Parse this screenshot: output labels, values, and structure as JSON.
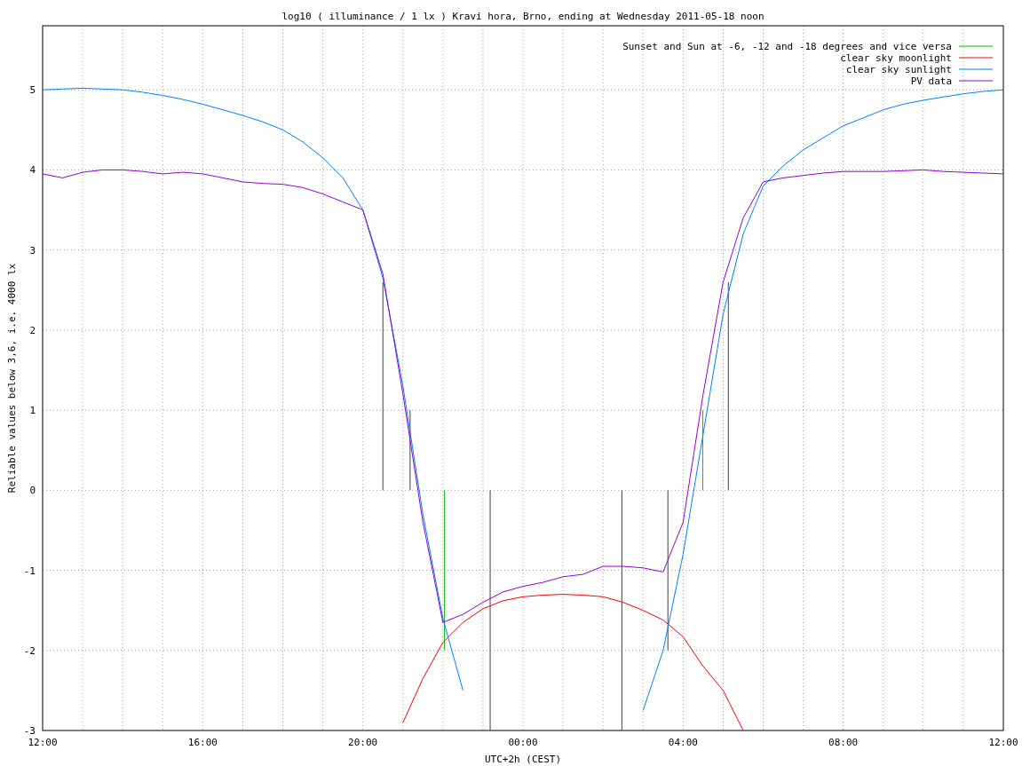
{
  "chart_data": {
    "type": "line",
    "title": "log10 ( illuminance / 1 lx ) Kravi hora, Brno, ending at Wednesday 2011-05-18 noon",
    "xlabel": "UTC+2h (CEST)",
    "ylabel": "Reliable values below 3,6, i.e. 4000 lx",
    "categories": [
      "12:00",
      null,
      null,
      null,
      null,
      null,
      null,
      null,
      "16:00",
      null,
      null,
      null,
      null,
      null,
      null,
      null,
      "20:00",
      null,
      null,
      null,
      null,
      null,
      null,
      null,
      "00:00",
      null,
      null,
      null,
      null,
      null,
      null,
      null,
      "04:00",
      null,
      null,
      null,
      null,
      null,
      null,
      null,
      "08:00",
      null,
      null,
      null,
      null,
      null,
      null,
      null,
      "12:00"
    ],
    "series": [
      {
        "name": "Sunset and Sun at -6, -12 and -18 degrees and vice versa",
        "color": "#00c000",
        "values": [
          null,
          null,
          null,
          null,
          null,
          null,
          null,
          null,
          null,
          null,
          null,
          null,
          null,
          null,
          null,
          null,
          null,
          null,
          null,
          null,
          null,
          null,
          null,
          null,
          null,
          null,
          null,
          null,
          null,
          null,
          null,
          null,
          null,
          null,
          null,
          null,
          null,
          null,
          null,
          null,
          null,
          null,
          null,
          null,
          null,
          null,
          null,
          null,
          null
        ]
      },
      {
        "name": "clear sky moonlight",
        "color": "#ff0000",
        "values": [
          null,
          null,
          null,
          null,
          null,
          null,
          null,
          null,
          null,
          null,
          null,
          null,
          null,
          null,
          null,
          null,
          null,
          null,
          -2.9,
          -2.35,
          -1.9,
          -1.65,
          -1.48,
          -1.38,
          -1.33,
          -1.31,
          -1.3,
          -1.31,
          -1.33,
          -1.4,
          -1.5,
          -1.62,
          -1.83,
          -2.2,
          -2.5,
          -3.0,
          null,
          null,
          null,
          null,
          null,
          null,
          null,
          null,
          null,
          null,
          null,
          null,
          null
        ]
      },
      {
        "name": "clear sky sunlight",
        "color": "#0080ff",
        "values": [
          5.0,
          5.01,
          5.02,
          5.01,
          5.0,
          4.97,
          4.93,
          4.88,
          4.82,
          4.75,
          4.68,
          4.6,
          4.5,
          4.35,
          4.15,
          3.9,
          3.5,
          2.65,
          1.3,
          -0.3,
          -1.6,
          -2.5,
          null,
          null,
          null,
          null,
          null,
          null,
          null,
          null,
          -2.75,
          -2.0,
          -0.8,
          0.7,
          2.2,
          3.2,
          3.8,
          4.05,
          4.25,
          4.4,
          4.55,
          4.65,
          4.75,
          4.82,
          4.87,
          4.91,
          4.95,
          4.98,
          5.0
        ]
      },
      {
        "name": "PV data",
        "color": "#9400d3",
        "values": [
          3.95,
          3.9,
          3.97,
          4.0,
          4.0,
          3.98,
          3.95,
          3.97,
          3.95,
          3.9,
          3.85,
          3.83,
          3.82,
          3.78,
          3.7,
          3.6,
          3.5,
          2.7,
          1.2,
          -0.4,
          -1.65,
          -1.55,
          -1.4,
          -1.27,
          -1.2,
          -1.15,
          -1.08,
          -1.05,
          -0.95,
          -0.95,
          -0.97,
          -1.02,
          -0.4,
          1.2,
          2.6,
          3.4,
          3.85,
          3.9,
          3.93,
          3.96,
          3.98,
          3.98,
          3.98,
          3.99,
          4.0,
          3.98,
          3.97,
          3.96,
          3.95
        ]
      }
    ],
    "ylim": [
      -3,
      5.8
    ],
    "grid": true,
    "legend": true,
    "yticks": [
      -3,
      -2,
      -1,
      0,
      1,
      2,
      3,
      4,
      5
    ]
  }
}
